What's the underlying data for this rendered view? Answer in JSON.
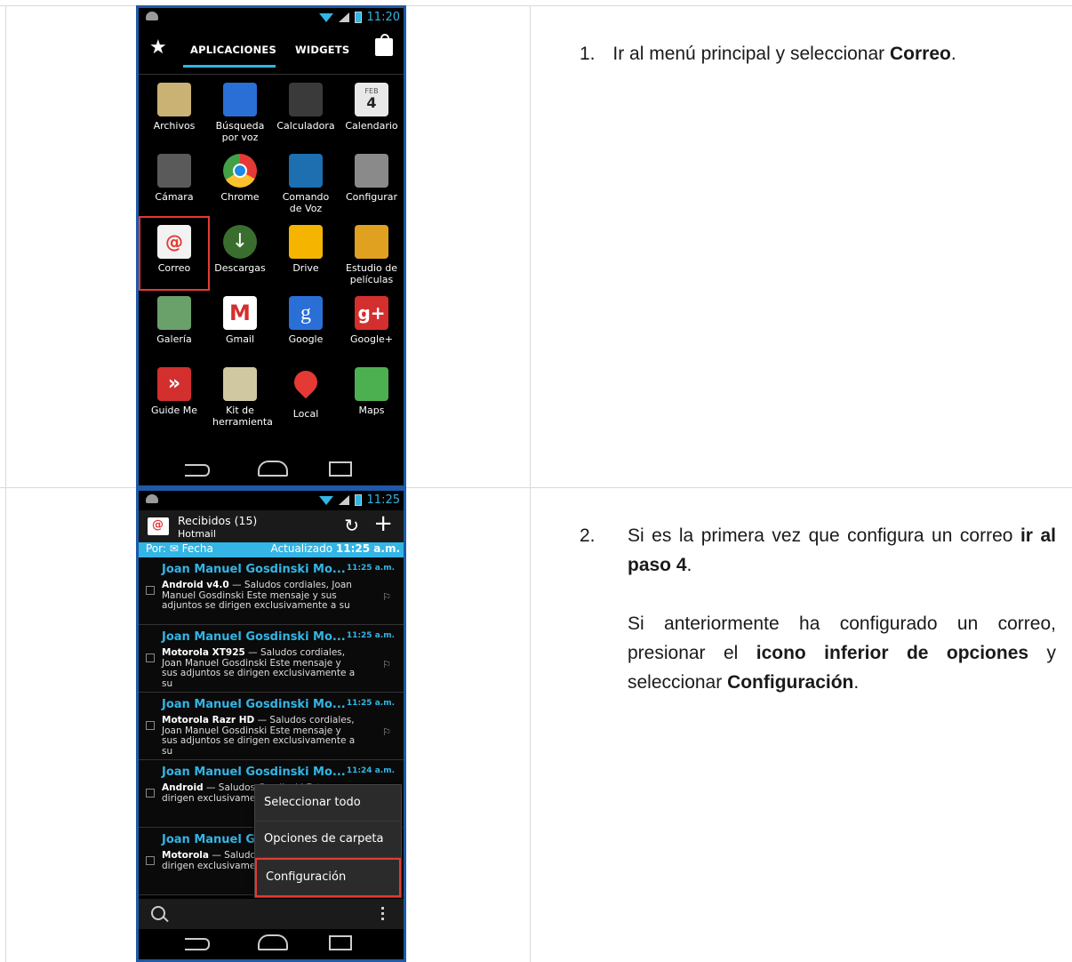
{
  "screen1": {
    "status_time": "11:20",
    "tabs": {
      "apps": "APLICACIONES",
      "widgets": "WIDGETS"
    },
    "apps": [
      {
        "label": "Archivos",
        "icon": "file-manager-icon",
        "color": "#c9b273"
      },
      {
        "label": "Búsqueda por voz",
        "icon": "voice-search-icon",
        "color": "#2a6fd6"
      },
      {
        "label": "Calculadora",
        "icon": "calculator-icon",
        "color": "#3a3a3a"
      },
      {
        "label": "Calendario",
        "icon": "calendar-icon",
        "color": "#e8e8e8"
      },
      {
        "label": "Cámara",
        "icon": "camera-icon",
        "color": "#5a5a5a"
      },
      {
        "label": "Chrome",
        "icon": "chrome-icon",
        "color": "#e53935"
      },
      {
        "label": "Comando de Voz",
        "icon": "voice-command-icon",
        "color": "#1d6fb0"
      },
      {
        "label": "Configurar",
        "icon": "settings-icon",
        "color": "#8a8a8a"
      },
      {
        "label": "Correo",
        "icon": "email-icon",
        "color": "#f2f2f2"
      },
      {
        "label": "Descargas",
        "icon": "downloads-icon",
        "color": "#3a6e2e"
      },
      {
        "label": "Drive",
        "icon": "drive-icon",
        "color": "#f4b400"
      },
      {
        "label": "Estudio de películas",
        "icon": "movie-studio-icon",
        "color": "#e0a020"
      },
      {
        "label": "Galería",
        "icon": "gallery-icon",
        "color": "#6aa06a"
      },
      {
        "label": "Gmail",
        "icon": "gmail-icon",
        "color": "#ffffff"
      },
      {
        "label": "Google",
        "icon": "google-search-icon",
        "color": "#2a6fd6"
      },
      {
        "label": "Google+",
        "icon": "google-plus-icon",
        "color": "#d32f2f"
      },
      {
        "label": "Guide Me",
        "icon": "guide-me-icon",
        "color": "#d32f2f"
      },
      {
        "label": "Kit de herramienta",
        "icon": "toolkit-icon",
        "color": "#d0c8a0"
      },
      {
        "label": "Local",
        "icon": "local-icon",
        "color": "#e53935"
      },
      {
        "label": "Maps",
        "icon": "maps-icon",
        "color": "#4caf50"
      }
    ],
    "calendar_month": "FEB",
    "calendar_day": "4"
  },
  "screen2": {
    "status_time": "11:25",
    "inbox_title": "Recibidos (15)",
    "account": "Hotmail",
    "sort_label": "Por:",
    "sort_value": "Fecha",
    "updated_label": "Actualizado",
    "updated_time": "11:25 a.m.",
    "emails": [
      {
        "sender": "Joan Manuel Gosdinski Mo...",
        "time": "11:25 a.m.",
        "subject": "Android v4.0",
        "snippet": " — Saludos cordiales,  Joan Manuel Gosdinski  Este mensaje y sus adjuntos se dirigen exclusivamente a su"
      },
      {
        "sender": "Joan Manuel Gosdinski Mo...",
        "time": "11:25 a.m.",
        "subject": "Motorola XT925",
        "snippet": " — Saludos cordiales,  Joan Manuel Gosdinski  Este mensaje y sus adjuntos se dirigen exclusivamente a su"
      },
      {
        "sender": "Joan Manuel Gosdinski Mo...",
        "time": "11:25 a.m.",
        "subject": "Motorola Razr HD",
        "snippet": " — Saludos cordiales,  Joan Manuel Gosdinski  Este mensaje y sus adjuntos se dirigen exclusivamente a su"
      },
      {
        "sender": "Joan Manuel Gosdinski Mo...",
        "time": "11:24 a.m.",
        "subject": "Android",
        "snippet": " — Saludos Gosdinski  Este mer dirigen exclusivame"
      },
      {
        "sender": "Joan Manuel Gc",
        "time": "",
        "subject": "Motorola",
        "snippet": " — Saludos Gosdinski  Este mer dirigen exclusivame"
      }
    ],
    "menu": [
      "Seleccionar todo",
      "Opciones de carpeta",
      "Configuración"
    ]
  },
  "steps": {
    "step1_num": "1.",
    "step1_a": "Ir al menú principal y seleccionar ",
    "step1_b": "Correo",
    "step1_c": ".",
    "step2_num": "2.",
    "step2_a": "Si es la primera vez que configura un correo ",
    "step2_b": "ir al paso 4",
    "step2_c": ".",
    "step2_d": "Si anteriormente ha configurado un correo, presionar el ",
    "step2_e": "icono inferior de opciones",
    "step2_f": " y seleccionar ",
    "step2_g": "Configuración",
    "step2_h": "."
  }
}
